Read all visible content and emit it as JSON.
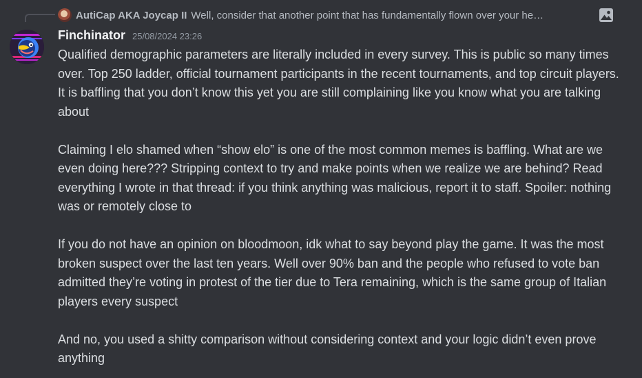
{
  "reply": {
    "author": "AutiCap AKA Joycap II",
    "text": "Well, consider that another point that has fundamentally flown over your he…",
    "attachment_icon": "image-icon"
  },
  "message": {
    "username": "Finchinator",
    "timestamp": "25/08/2024 23:26",
    "paragraphs": [
      "Qualified demographic parameters are literally included in every survey. This is public so many times over. Top 250 ladder, official tournament participants in the recent tournaments, and top circuit players. It is baffling that you don’t know this yet you are still complaining like you know what you are talking about",
      "Claiming I elo shamed when “show elo” is one of the most common memes is baffling. What are we even doing here??? Stripping context to try and make points when we realize we are behind? Read everything  I wrote in that thread: if you think anything was malicious, report it to staff. Spoiler: nothing was or remotely close to",
      "If you do not have an opinion on bloodmoon, idk what to say beyond play the game. It was the most broken suspect over the last ten years. Well over 90% ban and the people who refused to vote ban admitted they’re voting in protest of the tier due to Tera remaining, which is the same group of Italian players every suspect",
      "And no, you used a shitty comparison without considering context and your logic didn’t even prove anything"
    ]
  },
  "colors": {
    "background": "#313338",
    "username": "#f2f3f5",
    "text": "#dbdee1",
    "muted": "#b5bac1",
    "timestamp": "#949ba4"
  }
}
